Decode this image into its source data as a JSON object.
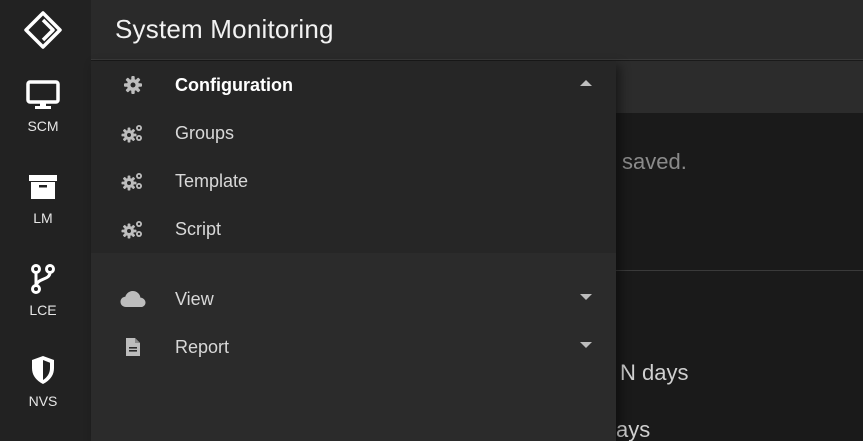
{
  "header": {
    "title": "System Monitoring"
  },
  "rail": {
    "items": [
      {
        "label": "SCM",
        "icon": "monitor-icon"
      },
      {
        "label": "LM",
        "icon": "archive-box-icon"
      },
      {
        "label": "LCE",
        "icon": "branch-icon"
      },
      {
        "label": "NVS",
        "icon": "shield-icon"
      }
    ]
  },
  "menu": {
    "configuration": {
      "label": "Configuration",
      "icon": "gear-icon",
      "expanded": true
    },
    "sub_items": [
      {
        "label": "Groups",
        "icon": "gears-icon"
      },
      {
        "label": "Template",
        "icon": "gears-icon"
      },
      {
        "label": "Script",
        "icon": "gears-icon"
      }
    ],
    "view": {
      "label": "View",
      "icon": "cloud-icon",
      "expanded": false
    },
    "report": {
      "label": "Report",
      "icon": "document-icon",
      "expanded": false
    }
  },
  "background": {
    "saved_text": "saved.",
    "days_text_1": "N days",
    "days_text_2": "ays"
  },
  "colors": {
    "rail_bg": "#222222",
    "header_bg": "#2a2a2a",
    "menu_bg": "#2b2b2b",
    "submenu_bg": "#262626"
  }
}
